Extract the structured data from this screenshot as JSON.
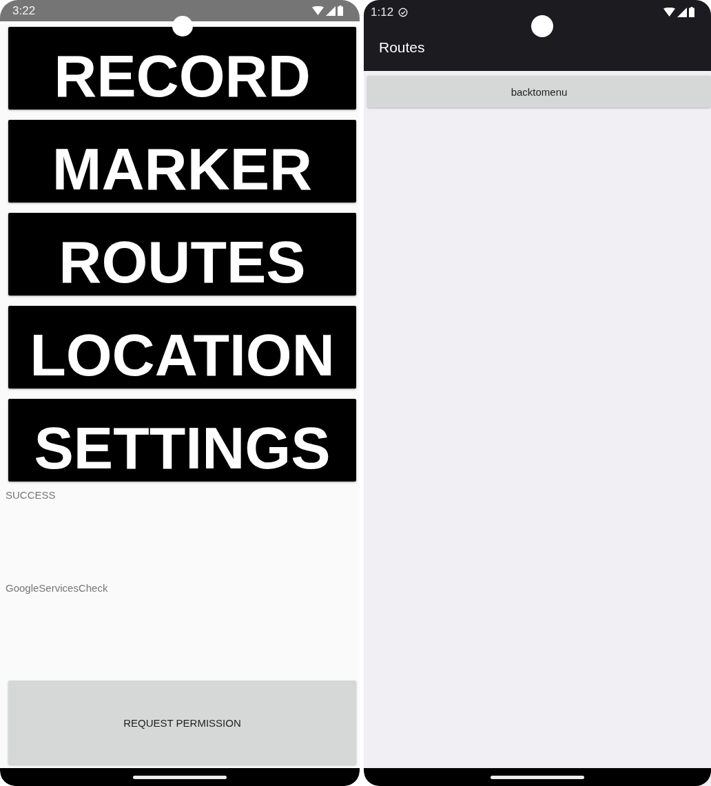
{
  "left_screen": {
    "status_bar": {
      "time": "3:22"
    },
    "menu_buttons": [
      "RECORD",
      "MARKER",
      "ROUTES",
      "LOCATION",
      "SETTINGS"
    ],
    "status_texts": [
      "SUCCESS",
      "GoogleServicesCheck"
    ],
    "permission_button": "REQUEST PERMISSION"
  },
  "right_screen": {
    "status_bar": {
      "time": "1:12"
    },
    "app_bar": {
      "title": "Routes"
    },
    "back_button": "backtomenu"
  }
}
